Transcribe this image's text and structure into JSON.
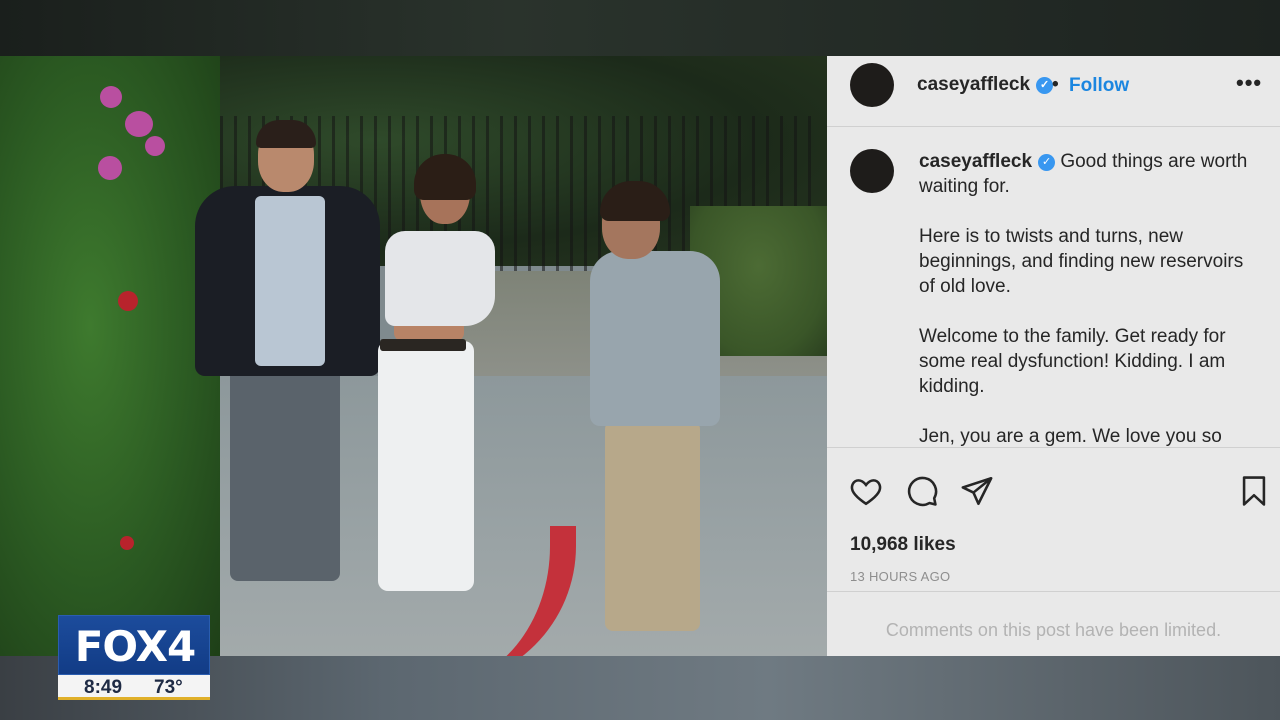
{
  "post": {
    "username": "caseyaffleck",
    "separator": "•",
    "follow_label": "Follow",
    "more_label": "•••",
    "caption_paragraphs": [
      "Good things are worth waiting for.",
      "Here is to twists and turns, new beginnings, and finding new reservoirs of old love.",
      "Welcome to the family. Get ready for some real dysfunction! Kidding. I am kidding.",
      "Jen, you are a gem. We love you so"
    ],
    "likes": "10,968 likes",
    "time_ago": "13 HOURS AGO",
    "comments_limited": "Comments on this post have been limited."
  },
  "icons": {
    "verified": "verified-badge-icon",
    "like": "heart-icon",
    "comment": "comment-bubble-icon",
    "share": "paper-plane-icon",
    "save": "bookmark-icon"
  },
  "broadcast": {
    "logo": "FOX4",
    "time": "8:49",
    "temperature": "73°"
  },
  "colors": {
    "follow_blue": "#1b86e0",
    "verified_blue": "#3897f0",
    "panel_bg": "#e9e9e9",
    "fox_blue": "#123c86",
    "fox_gold": "#e0b02a"
  }
}
